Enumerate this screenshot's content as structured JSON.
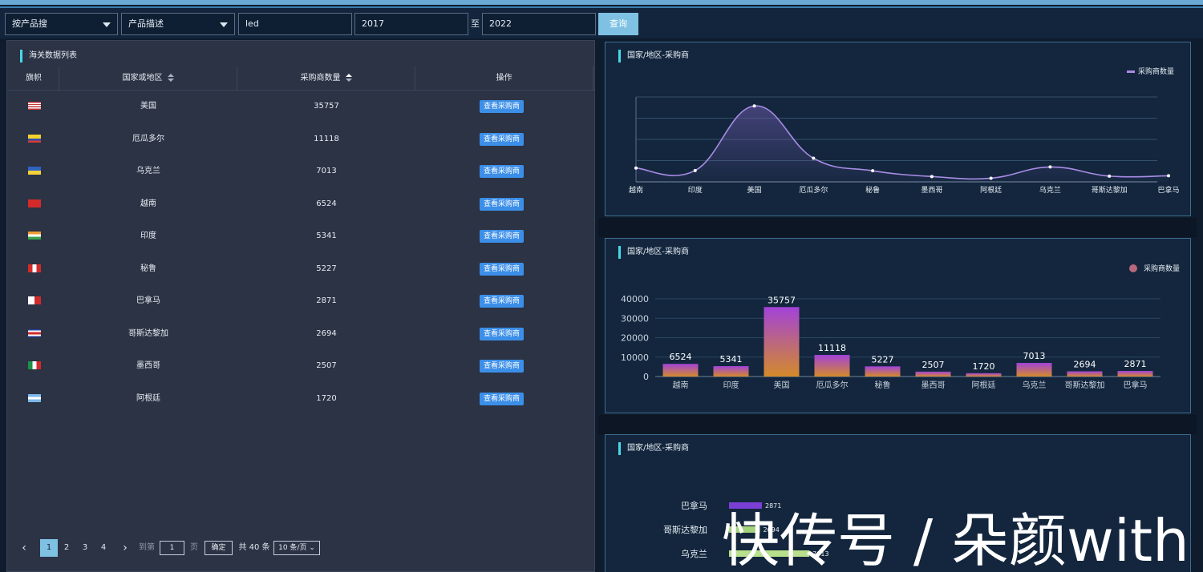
{
  "toolbar": {
    "search_mode": "按产品搜",
    "field": "产品描述",
    "keyword": "led",
    "year_from": "2017",
    "to_label": "至",
    "year_to": "2022",
    "query_label": "查询"
  },
  "table_panel": {
    "title": "海关数据列表",
    "headers": {
      "flag": "旗帜",
      "country": "国家或地区",
      "buyers": "采购商数量",
      "action": "操作"
    },
    "view_label": "查看采购商",
    "rows": [
      {
        "country": "美国",
        "buyers": "35757",
        "flag": "us"
      },
      {
        "country": "厄瓜多尔",
        "buyers": "11118",
        "flag": "ec"
      },
      {
        "country": "乌克兰",
        "buyers": "7013",
        "flag": "ua"
      },
      {
        "country": "越南",
        "buyers": "6524",
        "flag": "vn"
      },
      {
        "country": "印度",
        "buyers": "5341",
        "flag": "in"
      },
      {
        "country": "秘鲁",
        "buyers": "5227",
        "flag": "pe"
      },
      {
        "country": "巴拿马",
        "buyers": "2871",
        "flag": "pa"
      },
      {
        "country": "哥斯达黎加",
        "buyers": "2694",
        "flag": "cr"
      },
      {
        "country": "墨西哥",
        "buyers": "2507",
        "flag": "mx"
      },
      {
        "country": "阿根廷",
        "buyers": "1720",
        "flag": "ar"
      }
    ]
  },
  "pagination": {
    "prev": "‹",
    "pages": [
      "1",
      "2",
      "3",
      "4"
    ],
    "next": "›",
    "goto_label": "到第",
    "goto_value": "1",
    "page_unit": "页",
    "confirm": "确定",
    "total": "共 40 条",
    "page_size": "10 条/页"
  },
  "chart_data": [
    {
      "type": "line",
      "title": "国家/地区-采购商",
      "categories": [
        "越南",
        "印度",
        "美国",
        "厄瓜多尔",
        "秘鲁",
        "墨西哥",
        "阿根廷",
        "乌克兰",
        "哥斯达黎加",
        "巴拿马"
      ],
      "series": [
        {
          "name": "采购商数量",
          "values": [
            6524,
            5341,
            35757,
            11118,
            5227,
            2507,
            1720,
            7013,
            2694,
            2871
          ]
        }
      ],
      "color": "#a98ce6",
      "ylim": [
        0,
        40000
      ],
      "grid": true,
      "legend": "top-right",
      "smooth": true,
      "area": true
    },
    {
      "type": "bar",
      "title": "国家/地区-采购商",
      "categories": [
        "越南",
        "印度",
        "美国",
        "厄瓜多尔",
        "秘鲁",
        "墨西哥",
        "阿根廷",
        "乌克兰",
        "哥斯达黎加",
        "巴拿马"
      ],
      "series": [
        {
          "name": "采购商数量",
          "values": [
            6524,
            5341,
            35757,
            11118,
            5227,
            2507,
            1720,
            7013,
            2694,
            2871
          ]
        }
      ],
      "yticks": [
        "0",
        "10000",
        "20000",
        "30000",
        "40000"
      ],
      "ylim": [
        0,
        40000
      ],
      "grid": true,
      "legend": "top-right",
      "gradient": [
        "#a243d8",
        "#d48a2a"
      ],
      "data_labels": true
    },
    {
      "type": "bar",
      "orientation": "horizontal",
      "title": "国家/地区-采购商",
      "categories": [
        "巴拿马",
        "哥斯达黎加",
        "乌克兰"
      ],
      "values": [
        2871,
        2694,
        7013
      ],
      "colors": [
        "#7b3fd6",
        "#a4d37b",
        "#b8e08c"
      ],
      "data_labels": true
    }
  ],
  "watermark": "快传号 / 朵颜with"
}
